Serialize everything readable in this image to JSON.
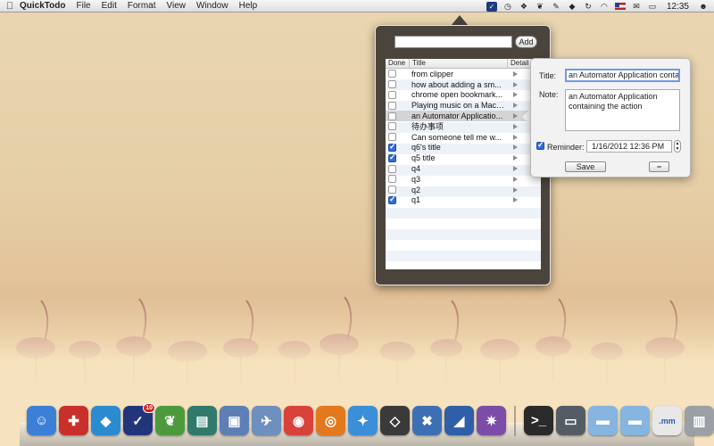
{
  "menubar": {
    "app_name": "QuickTodo",
    "menus": [
      "File",
      "Edit",
      "Format",
      "View",
      "Window",
      "Help"
    ],
    "clock": "12:35",
    "status_icons": [
      "quicktodo-icon",
      "clock-icon",
      "dropbox-icon",
      "evernote-icon",
      "pen-icon",
      "cube-icon",
      "sync-icon",
      "wifi-icon",
      "flag-icon",
      "mail-icon",
      "battery-icon",
      "user-icon"
    ]
  },
  "popover": {
    "new_todo_placeholder": "",
    "add_label": "Add",
    "columns": {
      "done": "Done",
      "title": "Title",
      "detail": "Detail"
    },
    "todos": [
      {
        "title": "from clipper",
        "done": false
      },
      {
        "title": "how about adding a sm...",
        "done": false
      },
      {
        "title": "chrome open bookmark...",
        "done": false
      },
      {
        "title": "Playing music on a Mac i...",
        "done": false
      },
      {
        "title": "an Automator Applicatio...",
        "done": false,
        "selected": true
      },
      {
        "title": "待办事项",
        "done": false
      },
      {
        "title": "Can someone tell me w...",
        "done": false
      },
      {
        "title": "q6's title",
        "done": true
      },
      {
        "title": "q5 title",
        "done": true
      },
      {
        "title": "q4",
        "done": false
      },
      {
        "title": "q3",
        "done": false
      },
      {
        "title": "q2",
        "done": false
      },
      {
        "title": "q1",
        "done": true
      }
    ]
  },
  "detail": {
    "title_label": "Title:",
    "title_value": "an Automator Application conta",
    "note_label": "Note:",
    "note_value": "an Automator Application containing the action",
    "reminder_label": "Reminder:",
    "reminder_checked": true,
    "reminder_value": "1/16/2012 12:36  PM",
    "save_label": "Save",
    "delete_label": "−"
  },
  "dock": {
    "items": [
      {
        "name": "finder-icon",
        "glyph": "☺",
        "color": "#3c7fd6"
      },
      {
        "name": "pdf-app-icon",
        "glyph": "✚",
        "color": "#c9302c"
      },
      {
        "name": "virtualbox-icon",
        "glyph": "◆",
        "color": "#2a8bd0"
      },
      {
        "name": "quicktodo-dock-icon",
        "glyph": "✓",
        "color": "#23357a",
        "badge": "10"
      },
      {
        "name": "evernote-dock-icon",
        "glyph": "❦",
        "color": "#4b9b3c"
      },
      {
        "name": "file-manager-icon",
        "glyph": "▤",
        "color": "#2f7a6b"
      },
      {
        "name": "preview-icon",
        "glyph": "▣",
        "color": "#5d7fb5"
      },
      {
        "name": "mail-stamp-icon",
        "glyph": "✈",
        "color": "#6f8fbf"
      },
      {
        "name": "chrome-icon",
        "glyph": "◉",
        "color": "#d9423a"
      },
      {
        "name": "firefox-icon",
        "glyph": "◎",
        "color": "#e3781c"
      },
      {
        "name": "safari-icon",
        "glyph": "✦",
        "color": "#3b8fd8"
      },
      {
        "name": "unity-icon",
        "glyph": "◇",
        "color": "#3a3a3a"
      },
      {
        "name": "xcode-icon",
        "glyph": "✖",
        "color": "#3d6fb5"
      },
      {
        "name": "instruments-icon",
        "glyph": "◢",
        "color": "#2e5fa8"
      },
      {
        "name": "wiring-icon",
        "glyph": "✷",
        "color": "#7c4da8"
      },
      {
        "name": "terminal-icon",
        "glyph": ">_",
        "color": "#2a2a2a"
      },
      {
        "name": "screen-icon",
        "glyph": "▭",
        "color": "#555c66"
      },
      {
        "name": "folder-icon",
        "glyph": "▬",
        "color": "#86b5e0"
      },
      {
        "name": "downloads-folder-icon",
        "glyph": "▬",
        "color": "#86b5e0"
      },
      {
        "name": "mm-file-icon",
        "glyph": ".mm",
        "color": "#e8e8e8"
      },
      {
        "name": "trash-icon",
        "glyph": "▥",
        "color": "#9aa0a6"
      }
    ]
  }
}
